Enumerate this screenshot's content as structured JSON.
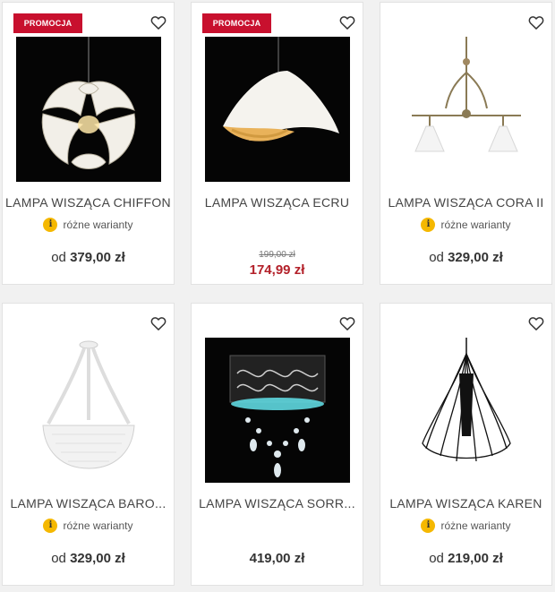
{
  "icons": {
    "favorite": "heart-outline-icon",
    "info": "info-icon"
  },
  "colors": {
    "promo": "#c8102e",
    "sale_price": "#b3212a",
    "info_badge": "#f5b800"
  },
  "products": [
    {
      "name": "LAMPA WISZĄCA CHIFFON",
      "badge": "PROMOCJA",
      "variants": "różne warianty",
      "info_glyph": "i",
      "price_prefix": "od",
      "price": "379,00",
      "currency": "zł"
    },
    {
      "name": "LAMPA WISZĄCA ECRU",
      "badge": "PROMOCJA",
      "old_price": "199,00 zł",
      "price": "174,99",
      "currency": "zł"
    },
    {
      "name": "LAMPA WISZĄCA CORA II",
      "variants": "różne warianty",
      "info_glyph": "i",
      "price_prefix": "od",
      "price": "329,00",
      "currency": "zł"
    },
    {
      "name": "LAMPA WISZĄCA BARO...",
      "variants": "różne warianty",
      "info_glyph": "i",
      "price_prefix": "od",
      "price": "329,00",
      "currency": "zł"
    },
    {
      "name": "LAMPA WISZĄCA SORR...",
      "price": "419,00",
      "currency": "zł"
    },
    {
      "name": "LAMPA WISZĄCA KAREN",
      "variants": "różne warianty",
      "info_glyph": "i",
      "price_prefix": "od",
      "price": "219,00",
      "currency": "zł"
    }
  ]
}
